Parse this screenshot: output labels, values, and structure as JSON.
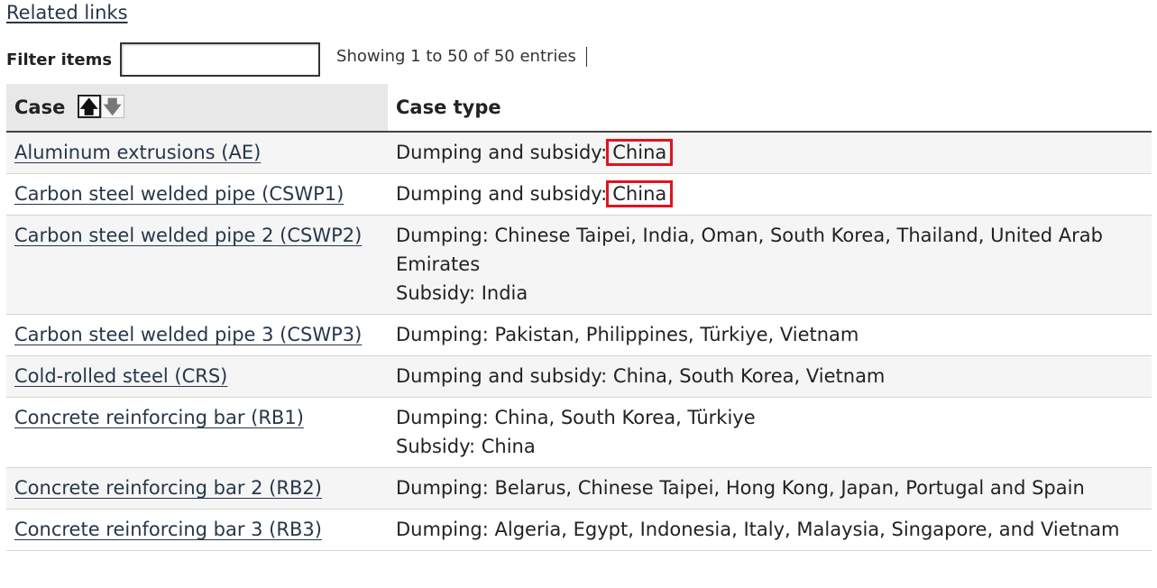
{
  "related_links": "Related links",
  "filter": {
    "label": "Filter items",
    "value": "",
    "placeholder": ""
  },
  "showing_text": "Showing 1 to 50 of 50 entries",
  "table": {
    "headers": {
      "case": "Case",
      "case_type": "Case type"
    },
    "sort_icons": [
      "arrow-up-icon",
      "arrow-down-icon"
    ],
    "rows": [
      {
        "case": "Aluminum extrusions (AE)",
        "type_prefix": "Dumping and subsidy:",
        "type_highlight": "China"
      },
      {
        "case": "Carbon steel welded pipe (CSWP1)",
        "type_prefix": "Dumping and subsidy:",
        "type_highlight": "China"
      },
      {
        "case": "Carbon steel welded pipe 2 (CSWP2)",
        "type_lines": [
          "Dumping: Chinese Taipei, India, Oman, South Korea, Thailand, United Arab Emirates",
          "Subsidy: India"
        ]
      },
      {
        "case": "Carbon steel welded pipe 3 (CSWP3)",
        "type_lines": [
          "Dumping: Pakistan, Philippines, Türkiye, Vietnam"
        ]
      },
      {
        "case": "Cold-rolled steel (CRS)",
        "type_lines": [
          "Dumping and subsidy: China, South Korea, Vietnam"
        ]
      },
      {
        "case": "Concrete reinforcing bar (RB1)",
        "type_lines": [
          "Dumping: China, South Korea, Türkiye",
          "Subsidy: China"
        ]
      },
      {
        "case": "Concrete reinforcing bar 2 (RB2)",
        "type_lines": [
          "Dumping: Belarus, Chinese Taipei, Hong Kong, Japan, Portugal and Spain"
        ]
      },
      {
        "case": "Concrete reinforcing bar 3 (RB3)",
        "type_lines": [
          "Dumping: Algeria, Egypt, Indonesia, Italy, Malaysia, Singapore, and Vietnam"
        ]
      }
    ]
  },
  "colors": {
    "link": "#26374a",
    "highlight_box": "#e0141e",
    "header_case_bg": "#e8e8e8",
    "row_alt_bg": "#f5f5f5"
  }
}
